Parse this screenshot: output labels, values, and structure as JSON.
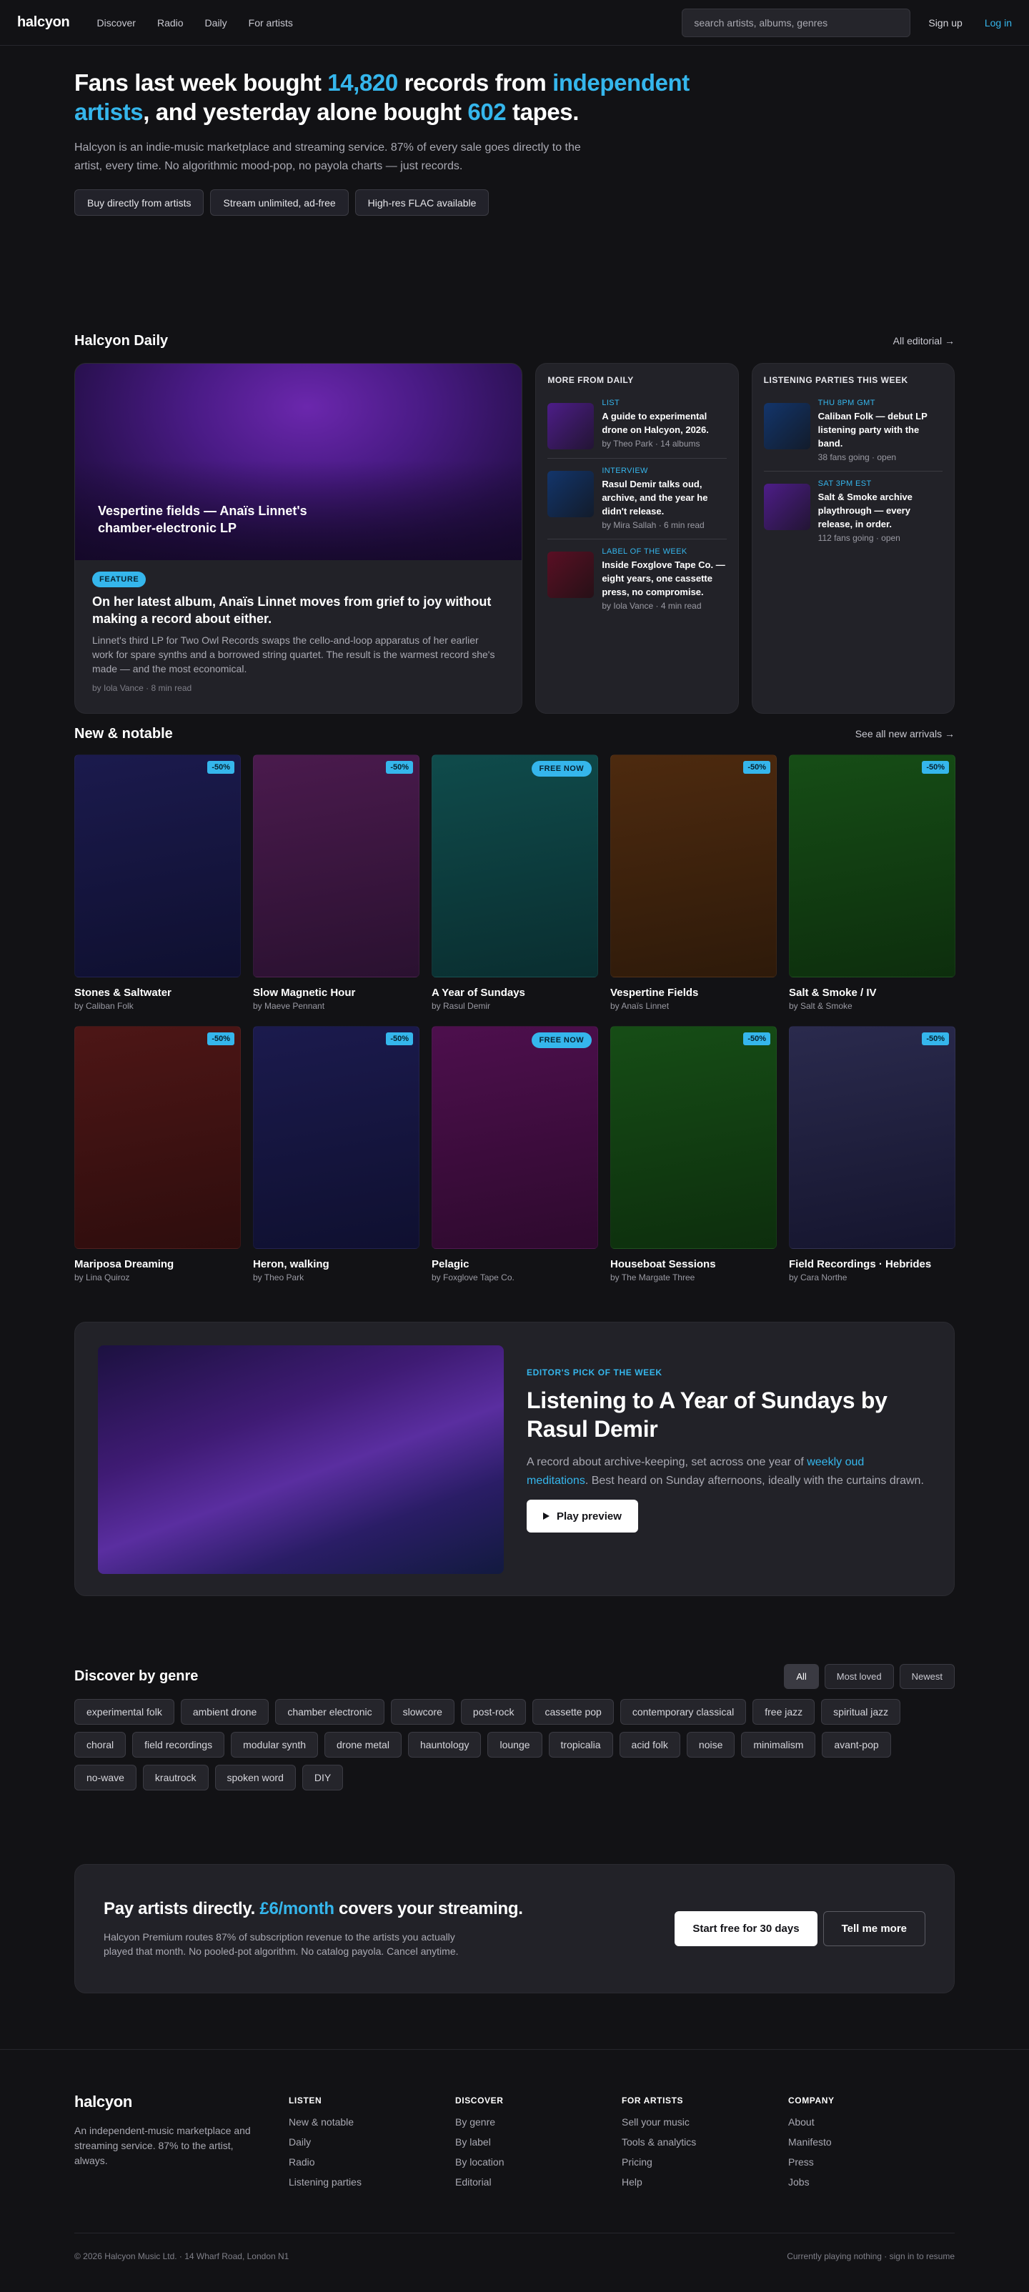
{
  "nav": {
    "logo": "halcyon",
    "links": [
      "Discover",
      "Radio",
      "Daily",
      "For artists"
    ],
    "search_placeholder": "search artists, albums, genres",
    "signup": "Sign up",
    "login": "Log in"
  },
  "hero": {
    "h1_1": "Fans last week bought ",
    "h1_num1": "14,820",
    "h1_2": " records from ",
    "h1_accent": "independent artists",
    "h1_3": ", and yesterday alone bought ",
    "h1_num2": "602",
    "h1_4": " tapes.",
    "subtitle": "Halcyon is an indie-music marketplace and streaming service. 87% of every sale goes directly to the artist, every time. No algorithmic mood-pop, no payola charts — just records.",
    "chips": [
      "Buy directly from artists",
      "Stream unlimited, ad-free",
      "High-res FLAC available"
    ]
  },
  "daily": {
    "title": "Halcyon Daily",
    "link": "All editorial →",
    "feature": {
      "image_title": "Vespertine fields — Anaïs Linnet's chamber-electronic LP",
      "badge": "FEATURE",
      "headline": "On her latest album, Anaïs Linnet moves from grief to joy without making a record about either.",
      "body": "Linnet's third LP for Two Owl Records swaps the cello-and-loop apparatus of her earlier work for spare synths and a borrowed string quartet. The result is the warmest record she's made — and the most economical.",
      "meta": "by Iola Vance · 8 min read"
    },
    "more": {
      "title": "More from Daily",
      "items": [
        {
          "kicker": "List",
          "title": "A guide to experimental drone on Halcyon, 2026.",
          "by": "by Theo Park · 14 albums",
          "color": "#4d1d88"
        },
        {
          "kicker": "Interview",
          "title": "Rasul Demir talks oud, archive, and the year he didn't release.",
          "by": "by Mira Sallah · 6 min read",
          "color": "#13356b"
        },
        {
          "kicker": "Label of the week",
          "title": "Inside Foxglove Tape Co. — eight years, one cassette press, no compromise.",
          "by": "by Iola Vance · 4 min read",
          "color": "#5a0f24"
        }
      ]
    },
    "parties": {
      "title": "Listening parties this week",
      "items": [
        {
          "kicker": "Thu 8PM GMT",
          "title": "Caliban Folk — debut LP listening party with the band.",
          "by": "38 fans going · open",
          "color": "#13356b"
        },
        {
          "kicker": "Sat 3PM EST",
          "title": "Salt & Smoke archive playthrough — every release, in order.",
          "by": "112 fans going · open",
          "color": "#4d1d88"
        }
      ]
    }
  },
  "notable": {
    "title": "New & notable",
    "link": "See all new arrivals →",
    "albums": [
      {
        "name": "Stones & Saltwater",
        "by": "by Caliban Folk",
        "tag": "-50%",
        "free": false,
        "c1": "#1b1a4d",
        "c2": "#0f1030"
      },
      {
        "name": "Slow Magnetic Hour",
        "by": "by Maeve Pennant",
        "tag": "-50%",
        "free": false,
        "c1": "#4a1a4d",
        "c2": "#2a1130"
      },
      {
        "name": "A Year of Sundays",
        "by": "by Rasul Demir",
        "tag": "FREE NOW",
        "free": true,
        "c1": "#0f4b4b",
        "c2": "#0a2e30"
      },
      {
        "name": "Vespertine Fields",
        "by": "by Anaïs Linnet",
        "tag": "-50%",
        "free": false,
        "c1": "#4d2a0f",
        "c2": "#2e1a0a"
      },
      {
        "name": "Salt & Smoke / IV",
        "by": "by Salt & Smoke",
        "tag": "-50%",
        "free": false,
        "c1": "#164d16",
        "c2": "#0d2e0d"
      },
      {
        "name": "Mariposa Dreaming",
        "by": "by Lina Quiroz",
        "tag": "-50%",
        "free": false,
        "c1": "#4d1616",
        "c2": "#2e0d0d"
      },
      {
        "name": "Heron, walking",
        "by": "by Theo Park",
        "tag": "-50%",
        "free": false,
        "c1": "#1b1a4d",
        "c2": "#0f1030"
      },
      {
        "name": "Pelagic",
        "by": "by Foxglove Tape Co.",
        "tag": "FREE NOW",
        "free": true,
        "c1": "#4d0f4d",
        "c2": "#2e0a2e"
      },
      {
        "name": "Houseboat Sessions",
        "by": "by The Margate Three",
        "tag": "-50%",
        "free": false,
        "c1": "#164d16",
        "c2": "#0d2e0d"
      },
      {
        "name": "Field Recordings · Hebrides",
        "by": "by Cara Northe",
        "tag": "-50%",
        "free": false,
        "c1": "#2a2a4d",
        "c2": "#15152e"
      }
    ]
  },
  "pick": {
    "kicker": "EDITOR'S PICK OF THE WEEK",
    "title": "Listening to A Year of Sundays by Rasul Demir",
    "body_1": "A record about archive-keeping, set across one year of ",
    "body_link": "weekly oud meditations",
    "body_2": ". Best heard on Sunday afternoons, ideally with the curtains drawn.",
    "button": "Play preview"
  },
  "genre": {
    "title": "Discover by genre",
    "filters": [
      "All",
      "Most loved",
      "Newest"
    ],
    "active_filter": "All",
    "tags": [
      "experimental folk",
      "ambient drone",
      "chamber electronic",
      "slowcore",
      "post-rock",
      "cassette pop",
      "contemporary classical",
      "free jazz",
      "spiritual jazz",
      "choral",
      "field recordings",
      "modular synth",
      "drone metal",
      "hauntology",
      "lounge",
      "tropicalia",
      "acid folk",
      "noise",
      "minimalism",
      "avant-pop",
      "no-wave",
      "krautrock",
      "spoken word",
      "DIY"
    ]
  },
  "premium": {
    "title_1": "Pay artists directly. ",
    "title_accent": "£6/month",
    "title_2": " covers your streaming.",
    "body": "Halcyon Premium routes 87% of subscription revenue to the artists you actually played that month. No pooled-pot algorithm. No catalog payola. Cancel anytime.",
    "primary": "Start free for 30 days",
    "secondary": "Tell me more"
  },
  "footer": {
    "logo": "halcyon",
    "tagline": "An independent-music marketplace and streaming service. 87% to the artist, always.",
    "cols": [
      {
        "title": "LISTEN",
        "items": [
          "New & notable",
          "Daily",
          "Radio",
          "Listening parties"
        ]
      },
      {
        "title": "DISCOVER",
        "items": [
          "By genre",
          "By label",
          "By location",
          "Editorial"
        ]
      },
      {
        "title": "FOR ARTISTS",
        "items": [
          "Sell your music",
          "Tools & analytics",
          "Pricing",
          "Help"
        ]
      },
      {
        "title": "COMPANY",
        "items": [
          "About",
          "Manifesto",
          "Press",
          "Jobs"
        ]
      }
    ],
    "copyright": "© 2026 Halcyon Music Ltd. · 14 Wharf Road, London N1",
    "status": "Currently playing nothing · sign in to resume"
  },
  "colors": {
    "accent": "#35b6ec",
    "bg": "#121215",
    "card": "#222228"
  }
}
